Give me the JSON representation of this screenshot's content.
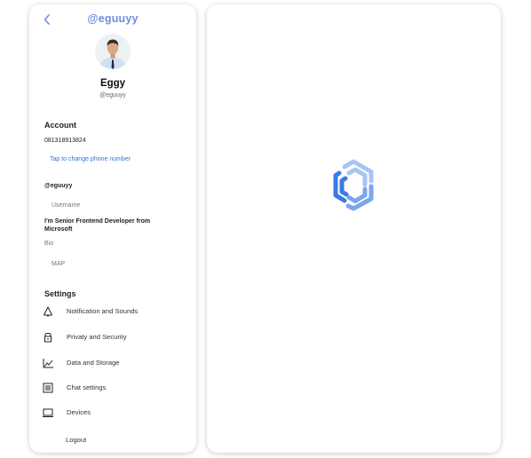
{
  "header": {
    "handle": "@eguuyy"
  },
  "profile": {
    "name": "Eggy",
    "handle": "@eguuyy"
  },
  "account": {
    "title": "Account",
    "phone": "081318913824",
    "change_phone_link": "Tap to change phone number",
    "username_value": "@eguuyy",
    "username_label": "Username",
    "bio_value": "I'm Senior Frontend Developer from Microsoft",
    "bio_label": "Bio",
    "location": "MAP"
  },
  "settings": {
    "title": "Settings",
    "items": [
      {
        "label": "Notification and Sounds",
        "icon": "bell-icon"
      },
      {
        "label": "Privaty and Security",
        "icon": "lock-icon"
      },
      {
        "label": "Data and Storage",
        "icon": "chart-icon"
      },
      {
        "label": "Chat settings",
        "icon": "chat-settings-icon"
      },
      {
        "label": "Devices",
        "icon": "laptop-icon"
      }
    ],
    "logout": "Logout"
  },
  "colors": {
    "accent": "#6f8fd9",
    "link": "#3a6fd8",
    "loader_light": "#a9c5f3",
    "loader_dark": "#3a7be3"
  }
}
